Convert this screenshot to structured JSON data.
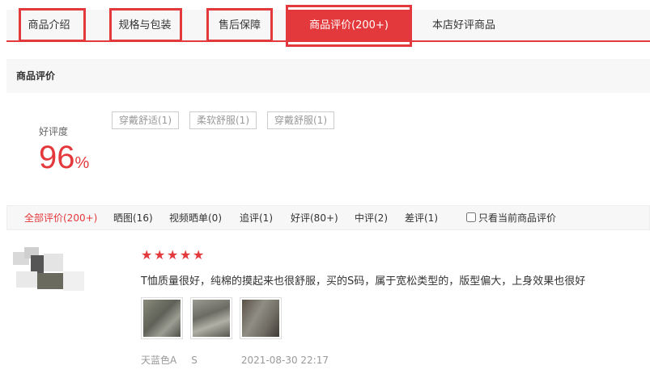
{
  "tabs": [
    {
      "label": "商品介绍",
      "active": false
    },
    {
      "label": "规格与包装",
      "active": false
    },
    {
      "label": "售后保障",
      "active": false
    },
    {
      "label": "商品评价(200+)",
      "active": true
    },
    {
      "label": "本店好评商品",
      "active": false
    }
  ],
  "section_title": "商品评价",
  "summary": {
    "good_rate_label": "好评度",
    "good_rate_value": "96",
    "good_rate_unit": "%",
    "tags": [
      "穿戴舒适(1)",
      "柔软舒服(1)",
      "穿戴舒服(1)"
    ]
  },
  "filters": [
    {
      "label": "全部评价(200+)",
      "active": true
    },
    {
      "label": "晒图(16)",
      "active": false
    },
    {
      "label": "视频晒单(0)",
      "active": false
    },
    {
      "label": "追评(1)",
      "active": false
    },
    {
      "label": "好评(80+)",
      "active": false
    },
    {
      "label": "中评(2)",
      "active": false
    },
    {
      "label": "差评(1)",
      "active": false
    }
  ],
  "only_current_label": "只看当前商品评价",
  "review": {
    "stars": 5,
    "text": "T恤质量很好，纯棉的摸起来也很舒服，买的S码，属于宽松类型的，版型偏大，上身效果也很好",
    "color": "天蓝色A",
    "size": "S",
    "date": "2021-08-30 22:17",
    "thumbnails": 3
  },
  "colors": {
    "accent": "#e4393c"
  }
}
